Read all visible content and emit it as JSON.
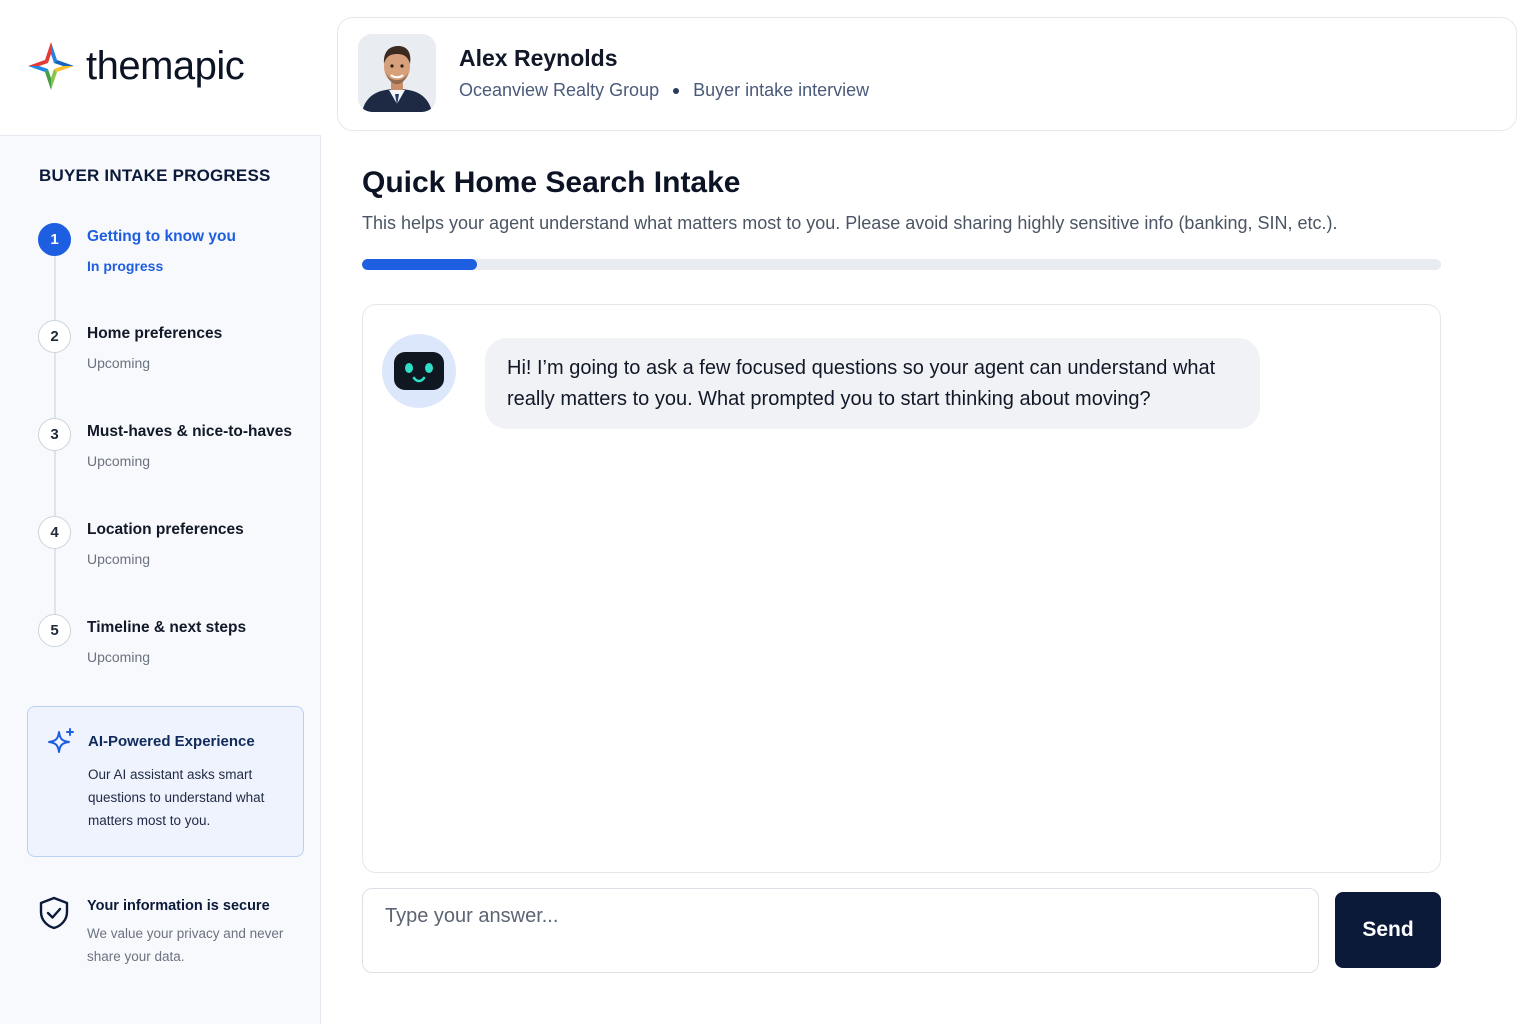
{
  "brand": {
    "name": "themapic"
  },
  "agent": {
    "name": "Alex Reynolds",
    "company": "Oceanview Realty Group",
    "context": "Buyer intake interview"
  },
  "sidebar": {
    "title": "BUYER INTAKE PROGRESS",
    "steps": [
      {
        "num": "1",
        "label": "Getting to know you",
        "status": "In progress",
        "active": true
      },
      {
        "num": "2",
        "label": "Home preferences",
        "status": "Upcoming",
        "active": false
      },
      {
        "num": "3",
        "label": "Must-haves & nice-to-haves",
        "status": "Upcoming",
        "active": false
      },
      {
        "num": "4",
        "label": "Location preferences",
        "status": "Upcoming",
        "active": false
      },
      {
        "num": "5",
        "label": "Timeline & next steps",
        "status": "Upcoming",
        "active": false
      }
    ],
    "ai_card": {
      "title": "AI-Powered Experience",
      "body": "Our AI assistant asks smart questions to understand what matters most to you."
    },
    "secure": {
      "title": "Your information is secure",
      "body": "We value your privacy and never share your data."
    }
  },
  "main": {
    "title": "Quick Home Search Intake",
    "subtitle": "This helps your agent understand what matters most to you. Please avoid sharing highly sensitive info (banking, SIN, etc.).",
    "progress_fraction": 0.107
  },
  "chat": {
    "bot_message": "Hi! I’m going to ask a few focused questions so your agent can understand what really matters to you. What prompted you to start thinking about moving?"
  },
  "composer": {
    "placeholder": "Type your answer...",
    "value": "",
    "send_label": "Send"
  },
  "colors": {
    "accent": "#1d5fe0",
    "send_button": "#0b1a38",
    "sidebar_bg": "#f8f9fc",
    "ai_card_bg": "#eef3fd"
  }
}
